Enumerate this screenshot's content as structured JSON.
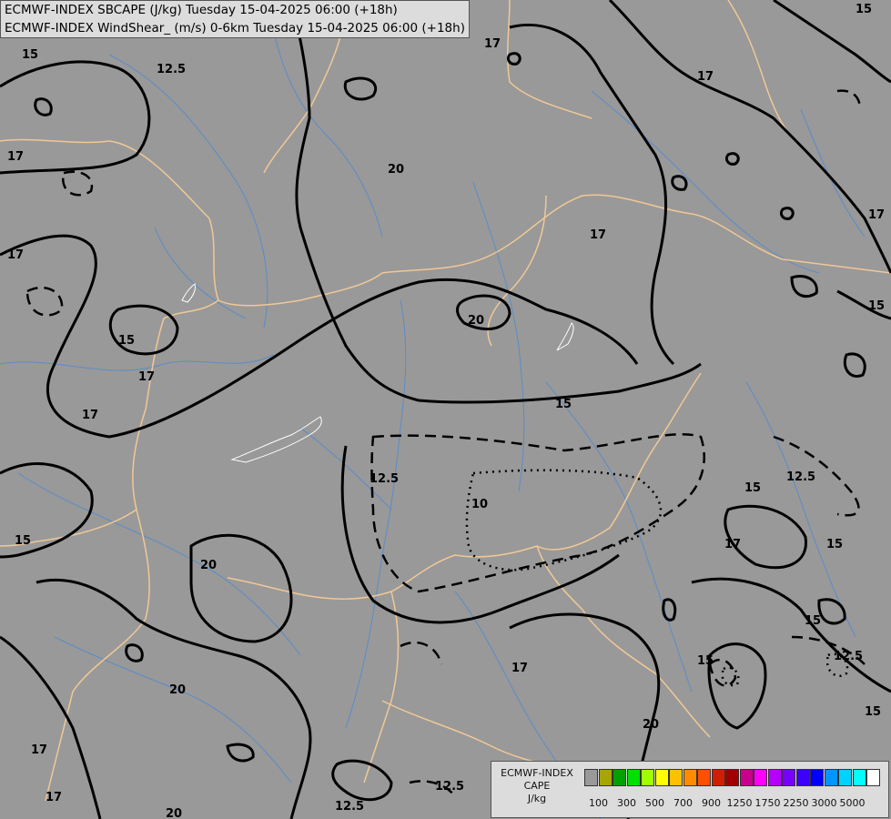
{
  "header": {
    "line1": "ECMWF-INDEX SBCAPE (J/kg) Tuesday 15-04-2025 06:00 (+18h)",
    "line2": "ECMWF-INDEX WindShear_ (m/s) 0-6km Tuesday 15-04-2025 06:00 (+18h)"
  },
  "legend": {
    "title_line1": "ECMWF-INDEX",
    "title_line2": "CAPE",
    "title_line3": "J/kg",
    "colors": [
      "#999999",
      "#a6a600",
      "#00a000",
      "#00e000",
      "#a0ff00",
      "#ffff00",
      "#ffc000",
      "#ff8c00",
      "#ff5000",
      "#d21e00",
      "#a00000",
      "#c8008c",
      "#ff00ff",
      "#b400ff",
      "#7800ff",
      "#3c00ff",
      "#0000ff",
      "#0096ff",
      "#00d2ff",
      "#00ffff",
      "#ffffff"
    ],
    "labels": [
      "100",
      "300",
      "500",
      "700",
      "900",
      "1250",
      "1750",
      "2250",
      "3000",
      "5000"
    ]
  },
  "map": {
    "contour_labels": [
      "15",
      "17",
      "20",
      "12.5",
      "10"
    ],
    "background_color": "#999999",
    "border_color": "#f0c896",
    "river_color": "#5a8cc8",
    "contour_color": "#000000"
  }
}
